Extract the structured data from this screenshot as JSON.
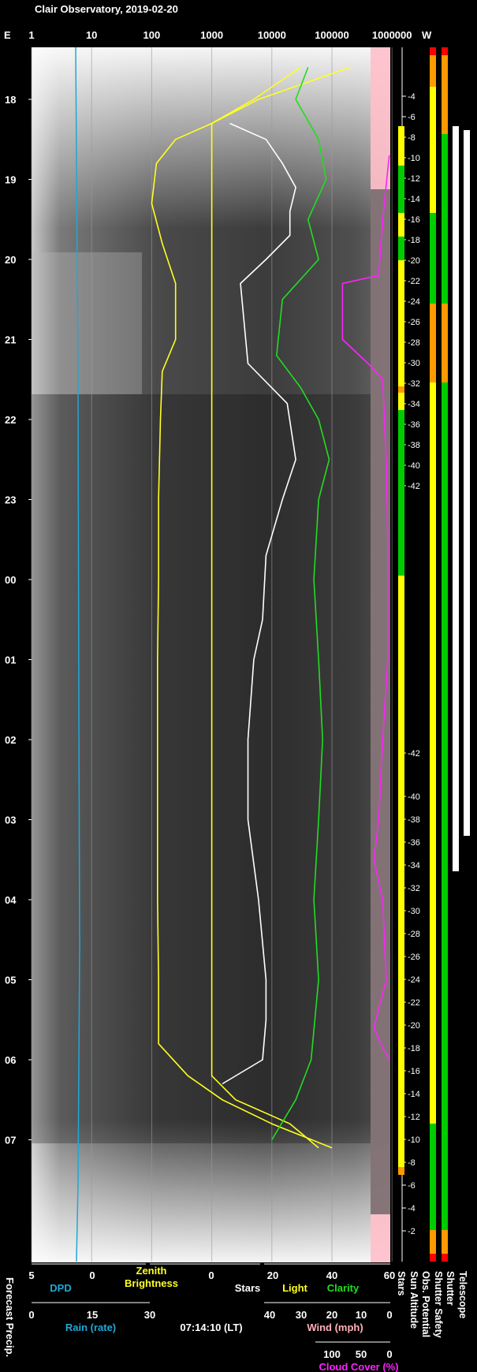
{
  "title": "Clair Observatory, 2019-02-20",
  "timestamp": "07:14:10 (LT)",
  "colors": {
    "background": "#000000",
    "white": "#ffffff",
    "dpd": "#1fa8d8",
    "zenith": "#ffff22",
    "stars": "#ffffff",
    "light": "#ffff22",
    "clarity": "#22dd22",
    "wind": "#ffb0b8",
    "cloud": "#ff22ff",
    "status_green": "#00cc00",
    "status_yellow": "#ffff00",
    "status_orange": "#ff9900",
    "status_red": "#ff0000"
  },
  "top_axis": {
    "left_label": "E",
    "right_label": "W",
    "ticks": [
      "1",
      "10",
      "100",
      "1000",
      "10000",
      "100000",
      "1000000"
    ]
  },
  "time_axis": {
    "labels": [
      "18",
      "19",
      "20",
      "21",
      "22",
      "23",
      "00",
      "01",
      "02",
      "03",
      "04",
      "05",
      "06",
      "07"
    ]
  },
  "sun_altitude_labels": [
    "-4",
    "-6",
    "-8",
    "-10",
    "-12",
    "-14",
    "-16",
    "-18",
    "-20",
    "-22",
    "-24",
    "-26",
    "-28",
    "-30",
    "-32",
    "-34",
    "-36",
    "-38",
    "-40",
    "-42",
    "-42",
    "-40",
    "-38",
    "-36",
    "-34",
    "-32",
    "-30",
    "-28",
    "-26",
    "-24",
    "-22",
    "-20",
    "-18",
    "-16",
    "-14",
    "-12",
    "-10",
    "-8",
    "-6",
    "-4",
    "-2"
  ],
  "bottom_axes": {
    "forecast_precip": "Forecast Precip.",
    "dpd": {
      "label": "DPD",
      "ticks": [
        "5",
        "0"
      ]
    },
    "zenith": {
      "label_line1": "Zenith",
      "label_line2": "Brightness",
      "ticks": [
        "0"
      ]
    },
    "stars_light_clarity": {
      "labels": [
        "Stars",
        "Light",
        "Clarity"
      ],
      "ticks": [
        "20",
        "40",
        "60"
      ]
    },
    "rain": {
      "label": "Rain (rate)",
      "ticks": [
        "0",
        "15",
        "30"
      ]
    },
    "wind": {
      "label": "Wind (mph)",
      "ticks": [
        "40",
        "30",
        "20",
        "10",
        "0"
      ]
    },
    "cloud": {
      "label": "Cloud Cover (%)",
      "ticks": [
        "100",
        "50",
        "0"
      ]
    },
    "right_columns": [
      "Stars",
      "Sun Altitude",
      "Obs. Potential",
      "Shutter Safety",
      "Shutter",
      "Telescope"
    ]
  },
  "chart_data": {
    "type": "line",
    "title": "Clair Observatory, 2019-02-20",
    "x_scale": "log",
    "x_ticks": [
      1,
      10,
      100,
      1000,
      10000,
      100000,
      1000000
    ],
    "time_range": [
      "17:30",
      "07:15"
    ],
    "series": [
      {
        "name": "Zenith Brightness",
        "points": [
          [
            17.6,
            200000
          ],
          [
            18.0,
            6000
          ],
          [
            18.3,
            1000
          ],
          [
            18.5,
            250
          ],
          [
            18.8,
            120
          ],
          [
            19.3,
            100
          ],
          [
            19.8,
            150
          ],
          [
            20.3,
            250
          ],
          [
            21.0,
            250
          ],
          [
            21.4,
            150
          ],
          [
            22.0,
            140
          ],
          [
            23.0,
            130
          ],
          [
            0.0,
            130
          ],
          [
            1.0,
            125
          ],
          [
            2.0,
            125
          ],
          [
            3.0,
            125
          ],
          [
            4.0,
            125
          ],
          [
            5.0,
            130
          ],
          [
            5.8,
            130
          ],
          [
            6.2,
            400
          ],
          [
            6.5,
            1500
          ],
          [
            6.8,
            10000
          ],
          [
            7.1,
            100000
          ]
        ]
      },
      {
        "name": "Stars",
        "points": [
          [
            18.3,
            2000
          ],
          [
            18.5,
            8000
          ],
          [
            18.8,
            15000
          ],
          [
            19.1,
            25000
          ],
          [
            19.4,
            20000
          ],
          [
            19.7,
            20000
          ],
          [
            20.0,
            8000
          ],
          [
            20.3,
            3000
          ],
          [
            21.3,
            4000
          ],
          [
            21.8,
            18000
          ],
          [
            22.5,
            25000
          ],
          [
            23.0,
            15000
          ],
          [
            23.7,
            8000
          ],
          [
            0.5,
            7000
          ],
          [
            1.0,
            5000
          ],
          [
            2.0,
            4000
          ],
          [
            3.0,
            4000
          ],
          [
            4.0,
            6000
          ],
          [
            5.0,
            8000
          ],
          [
            5.5,
            8000
          ],
          [
            6.0,
            7000
          ],
          [
            6.3,
            1500
          ]
        ]
      },
      {
        "name": "Light",
        "points": [
          [
            17.6,
            30000
          ],
          [
            18.0,
            5000
          ],
          [
            18.3,
            1000
          ],
          [
            19.0,
            1000
          ],
          [
            21.0,
            1000
          ],
          [
            23.0,
            1000
          ],
          [
            1.0,
            1000
          ],
          [
            3.0,
            1000
          ],
          [
            5.0,
            1000
          ],
          [
            6.2,
            1000
          ],
          [
            6.5,
            2500
          ],
          [
            6.8,
            20000
          ],
          [
            7.1,
            60000
          ]
        ]
      },
      {
        "name": "Clarity",
        "points": [
          [
            17.6,
            40000
          ],
          [
            18.0,
            25000
          ],
          [
            18.5,
            60000
          ],
          [
            19.0,
            80000
          ],
          [
            19.5,
            40000
          ],
          [
            20.0,
            60000
          ],
          [
            20.5,
            15000
          ],
          [
            21.2,
            12000
          ],
          [
            21.6,
            30000
          ],
          [
            22.0,
            60000
          ],
          [
            22.5,
            90000
          ],
          [
            23.0,
            60000
          ],
          [
            0.0,
            50000
          ],
          [
            1.0,
            60000
          ],
          [
            2.0,
            70000
          ],
          [
            3.0,
            60000
          ],
          [
            4.0,
            50000
          ],
          [
            5.0,
            60000
          ],
          [
            6.0,
            45000
          ],
          [
            6.5,
            25000
          ],
          [
            7.0,
            10000
          ]
        ]
      },
      {
        "name": "Cloud Cover",
        "points": [
          [
            18.7,
            900000
          ],
          [
            19.5,
            700000
          ],
          [
            20.2,
            600000
          ],
          [
            20.3,
            150000
          ],
          [
            21.0,
            150000
          ],
          [
            21.3,
            400000
          ],
          [
            21.5,
            700000
          ],
          [
            22.5,
            800000
          ],
          [
            23.5,
            850000
          ],
          [
            1.0,
            850000
          ],
          [
            2.0,
            700000
          ],
          [
            3.0,
            600000
          ],
          [
            3.5,
            500000
          ],
          [
            4.0,
            700000
          ],
          [
            5.0,
            800000
          ],
          [
            5.6,
            500000
          ],
          [
            5.8,
            650000
          ],
          [
            6.0,
            900000
          ]
        ]
      }
    ]
  }
}
